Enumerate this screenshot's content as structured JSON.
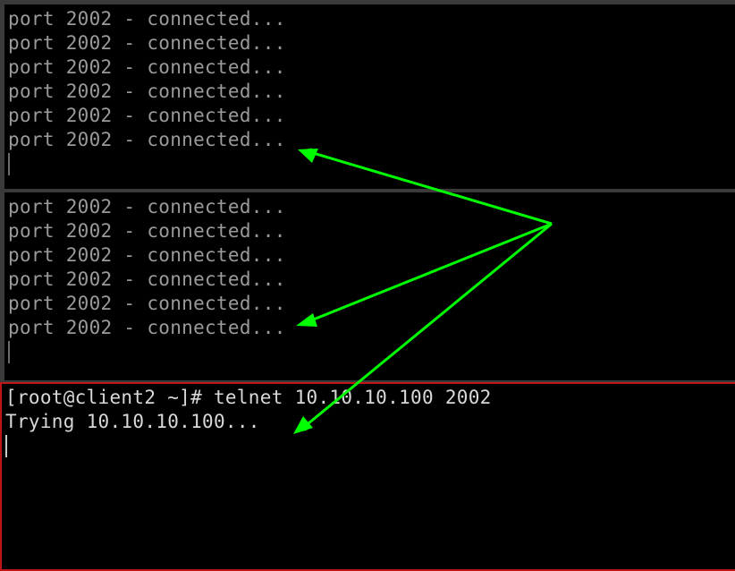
{
  "panes": {
    "top": {
      "lines": [
        "port 2002 - connected...",
        "port 2002 - connected...",
        "port 2002 - connected...",
        "port 2002 - connected...",
        "port 2002 - connected...",
        "port 2002 - connected..."
      ]
    },
    "middle": {
      "lines": [
        "port 2002 - connected...",
        "port 2002 - connected...",
        "port 2002 - connected...",
        "port 2002 - connected...",
        "port 2002 - connected...",
        "port 2002 - connected..."
      ]
    },
    "bottom": {
      "lines": [
        "[root@client2 ~]# telnet 10.10.10.100 2002",
        "Trying 10.10.10.100..."
      ]
    }
  },
  "colors": {
    "inactive_text": "#9a9a9a",
    "active_text": "#d8d8d8",
    "active_border": "#c01515",
    "pane_divider": "#3a3a3a",
    "annotation_arrow": "#00ff00",
    "background": "#000000"
  },
  "annotation": {
    "type": "arrows",
    "count": 3
  }
}
